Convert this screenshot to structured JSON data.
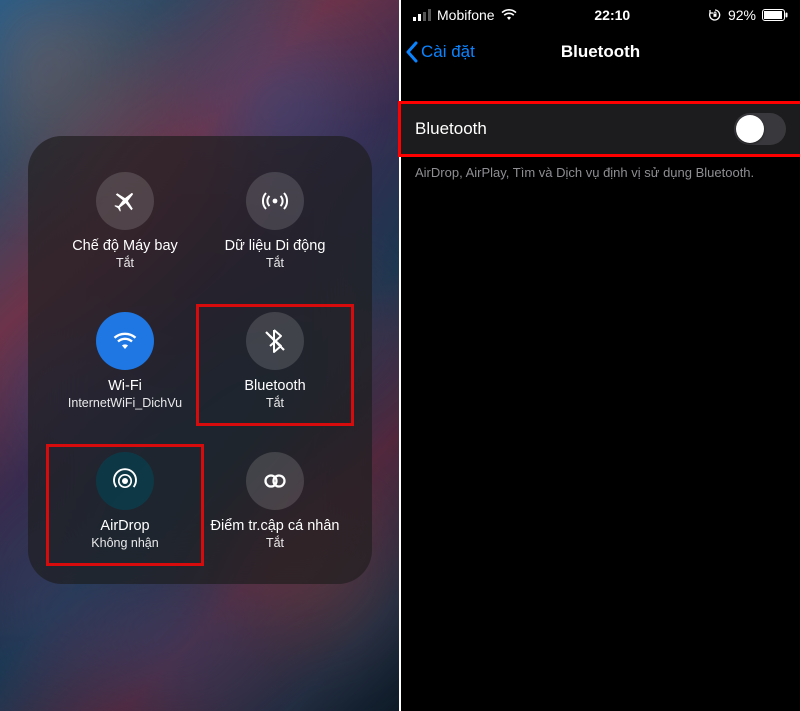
{
  "left": {
    "tiles": [
      {
        "key": "airplane",
        "title": "Chế độ Máy bay",
        "subtitle": "Tắt",
        "bubble": "bubble-dim",
        "icon": "airplane-icon"
      },
      {
        "key": "cellular",
        "title": "Dữ liệu Di động",
        "subtitle": "Tắt",
        "bubble": "bubble-dim",
        "icon": "cellular-icon"
      },
      {
        "key": "wifi",
        "title": "Wi-Fi",
        "subtitle": "InternetWiFi_DichVu",
        "bubble": "bubble-blue",
        "icon": "wifi-icon"
      },
      {
        "key": "bluetooth",
        "title": "Bluetooth",
        "subtitle": "Tắt",
        "bubble": "bubble-dim",
        "icon": "bluetooth-off-icon",
        "highlight": true
      },
      {
        "key": "airdrop",
        "title": "AirDrop",
        "subtitle": "Không nhận",
        "bubble": "bubble-teal",
        "icon": "airdrop-icon",
        "highlight": true
      },
      {
        "key": "hotspot",
        "title": "Điểm tr.cập cá nhân",
        "subtitle": "Tắt",
        "bubble": "bubble-dim",
        "icon": "hotspot-icon"
      }
    ]
  },
  "right": {
    "status": {
      "carrier": "Mobifone",
      "time": "22:10",
      "battery_pct": "92%"
    },
    "nav": {
      "back_label": "Cài đặt",
      "title": "Bluetooth"
    },
    "row": {
      "label": "Bluetooth",
      "enabled": false
    },
    "footer": "AirDrop, AirPlay, Tìm và Dịch vụ định vị sử dụng Bluetooth."
  },
  "colors": {
    "accent": "#0a84ff",
    "highlight": "#ff0000"
  }
}
